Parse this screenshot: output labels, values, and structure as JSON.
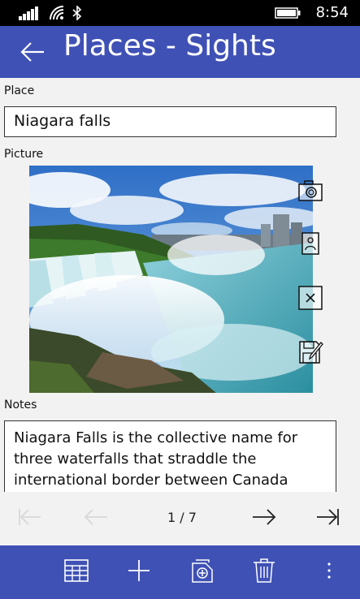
{
  "status_bar": {
    "time": "8:54",
    "icons": [
      "signal-icon",
      "wifi-icon",
      "bluetooth-icon",
      "battery-icon"
    ]
  },
  "header": {
    "title": "Places - Sights",
    "back_icon": "back-arrow-icon"
  },
  "form": {
    "place_label": "Place",
    "place_value": "Niagara falls",
    "picture_label": "Picture",
    "picture_actions": [
      "camera-icon",
      "gallery-icon",
      "remove-picture-icon",
      "save-picture-icon"
    ],
    "notes_label": "Notes",
    "notes_value": "Niagara Falls is the collective name for three waterfalls that straddle the international border between Canada"
  },
  "pager": {
    "position_text": "1 / 7",
    "first_enabled": false,
    "previous_enabled": false,
    "next_enabled": true,
    "last_enabled": true
  },
  "app_bar": {
    "buttons": [
      "table-view-icon",
      "add-icon",
      "duplicate-icon",
      "delete-icon",
      "more-icon"
    ]
  },
  "colors": {
    "accent": "#3f51b5",
    "background": "#f2f2f2",
    "disabled": "#d8d8d8"
  }
}
